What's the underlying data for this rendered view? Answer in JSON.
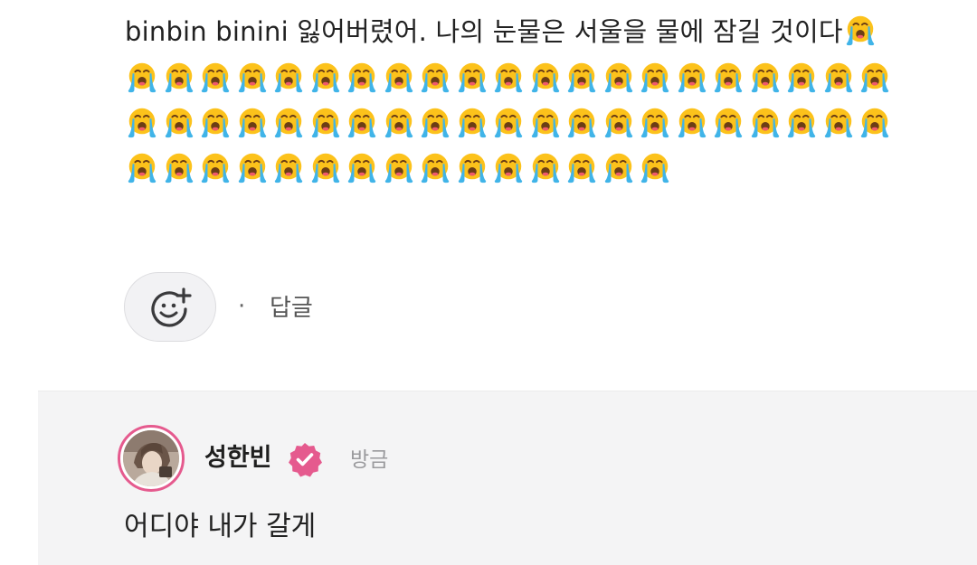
{
  "post": {
    "text": "binbin binini 잃어버렸어. 나의 눈물은 서울을 물에 잠길 것이다",
    "trailing_emoji": "loudly-crying-face",
    "emoji_icon": "loudly-crying-face",
    "emoji_count": 57
  },
  "actions": {
    "reaction_icon": "add-reaction-smiley-icon",
    "separator": "·",
    "reply_label": "답글"
  },
  "reply": {
    "author": "성한빈",
    "verified_icon": "verified-badge-icon",
    "time": "방금",
    "text": "어디야 내가 갈게"
  },
  "colors": {
    "accent_pink": "#e55a8e",
    "reply_bg": "#f4f4f5",
    "emoji_yellow": "#fcc21b",
    "tears_blue": "#40b4e8"
  }
}
